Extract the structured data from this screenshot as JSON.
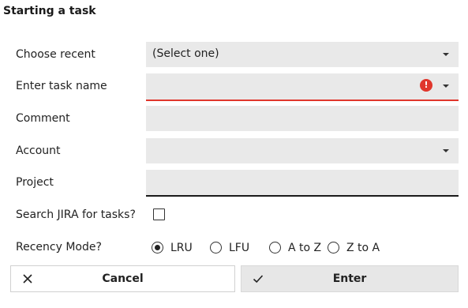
{
  "title": "Starting a task",
  "fields": {
    "recent": {
      "label": "Choose recent",
      "value": "(Select one)"
    },
    "task_name": {
      "label": "Enter task name",
      "value": "",
      "error_icon": "!"
    },
    "comment": {
      "label": "Comment",
      "value": ""
    },
    "account": {
      "label": "Account",
      "value": ""
    },
    "project": {
      "label": "Project",
      "value": ""
    }
  },
  "search_jira": {
    "label": "Search JIRA for tasks?",
    "checked": false
  },
  "recency": {
    "label": "Recency Mode?",
    "options": [
      "LRU",
      "LFU",
      "A to Z",
      "Z to A"
    ],
    "selected": "LRU"
  },
  "buttons": {
    "cancel": {
      "label": "Cancel",
      "icon": "close-icon"
    },
    "enter": {
      "label": "Enter",
      "icon": "check-icon"
    }
  },
  "colors": {
    "field_bg": "#e9e9e9",
    "error": "#e0362c",
    "button_enter_bg": "#e7e7e7"
  }
}
